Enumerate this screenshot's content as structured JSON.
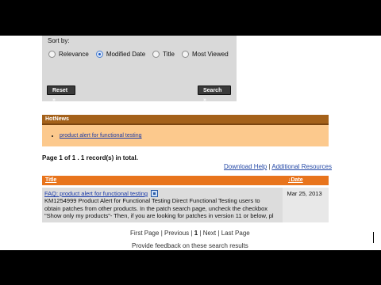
{
  "search": {
    "sort_label": "Sort by:",
    "sort_options": [
      {
        "label": "Relevance",
        "checked": false
      },
      {
        "label": "Modified Date",
        "checked": true
      },
      {
        "label": "Title",
        "checked": false
      },
      {
        "label": "Most Viewed",
        "checked": false
      }
    ],
    "reset_label": "Reset »",
    "search_label": "Search »"
  },
  "hotnews": {
    "heading": "HotNews",
    "items": [
      "product alert for functional testing"
    ]
  },
  "summary": {
    "page_info": "Page 1 of 1 . 1 record(s) in total.",
    "download_help": "Download Help",
    "separator": "|",
    "additional_resources": "Additional Resources"
  },
  "results": {
    "col_title": "Title",
    "col_date": "↓Date",
    "rows": [
      {
        "title": "FAQ: product alert for functional testing",
        "snippet_lines": [
          "KM1254999 Product Alert for Functional Testing Direct Functional Testing users to",
          "obtain patches from other products. In the patch search page, uncheck the checkbox",
          "\"Show only my products\"- Then, if you are looking for patches in version 11 or below, pl"
        ],
        "date": "Mar 25, 2013"
      }
    ]
  },
  "pager": {
    "first": "First Page",
    "previous": "Previous",
    "current": "1",
    "next": "Next",
    "last": "Last Page",
    "sep": "|"
  },
  "feedback": "Provide feedback on these search results"
}
